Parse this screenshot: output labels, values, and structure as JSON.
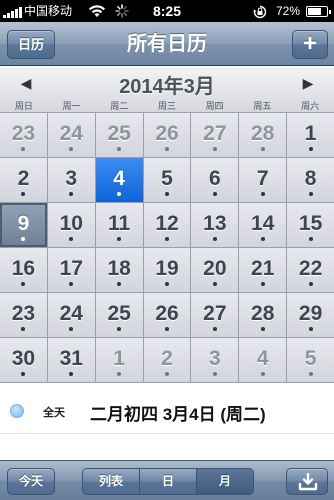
{
  "status_bar": {
    "carrier": "中国移动",
    "time": "8:25",
    "battery": "72%",
    "battery_level": 0.72,
    "icons": [
      "signal-icon",
      "wifi-icon",
      "activity-spinner-icon",
      "orientation-lock-icon",
      "battery-icon"
    ]
  },
  "nav": {
    "left_button": "日历",
    "title": "所有日历",
    "right_button": "+"
  },
  "calendar": {
    "month_title": "2014年3月",
    "prev_icon": "◀",
    "next_icon": "▶",
    "weekdays": [
      "周日",
      "周一",
      "周二",
      "周三",
      "周四",
      "周五",
      "周六"
    ],
    "weeks": [
      [
        {
          "d": "23",
          "o": true,
          "e": true
        },
        {
          "d": "24",
          "o": true,
          "e": true
        },
        {
          "d": "25",
          "o": true,
          "e": true
        },
        {
          "d": "26",
          "o": true,
          "e": true
        },
        {
          "d": "27",
          "o": true,
          "e": true
        },
        {
          "d": "28",
          "o": true,
          "e": true
        },
        {
          "d": "1",
          "o": false,
          "e": true
        }
      ],
      [
        {
          "d": "2",
          "o": false,
          "e": true
        },
        {
          "d": "3",
          "o": false,
          "e": true
        },
        {
          "d": "4",
          "o": false,
          "e": true,
          "s": true
        },
        {
          "d": "5",
          "o": false,
          "e": true
        },
        {
          "d": "6",
          "o": false,
          "e": true
        },
        {
          "d": "7",
          "o": false,
          "e": true
        },
        {
          "d": "8",
          "o": false,
          "e": true
        }
      ],
      [
        {
          "d": "9",
          "o": false,
          "e": true,
          "t": true
        },
        {
          "d": "10",
          "o": false,
          "e": true
        },
        {
          "d": "11",
          "o": false,
          "e": true
        },
        {
          "d": "12",
          "o": false,
          "e": true
        },
        {
          "d": "13",
          "o": false,
          "e": true
        },
        {
          "d": "14",
          "o": false,
          "e": true
        },
        {
          "d": "15",
          "o": false,
          "e": true
        }
      ],
      [
        {
          "d": "16",
          "o": false,
          "e": true
        },
        {
          "d": "17",
          "o": false,
          "e": true
        },
        {
          "d": "18",
          "o": false,
          "e": true
        },
        {
          "d": "19",
          "o": false,
          "e": true
        },
        {
          "d": "20",
          "o": false,
          "e": true
        },
        {
          "d": "21",
          "o": false,
          "e": true
        },
        {
          "d": "22",
          "o": false,
          "e": true
        }
      ],
      [
        {
          "d": "23",
          "o": false,
          "e": true
        },
        {
          "d": "24",
          "o": false,
          "e": true
        },
        {
          "d": "25",
          "o": false,
          "e": true
        },
        {
          "d": "26",
          "o": false,
          "e": true
        },
        {
          "d": "27",
          "o": false,
          "e": true
        },
        {
          "d": "28",
          "o": false,
          "e": true
        },
        {
          "d": "29",
          "o": false,
          "e": true
        }
      ],
      [
        {
          "d": "30",
          "o": false,
          "e": true
        },
        {
          "d": "31",
          "o": false,
          "e": true
        },
        {
          "d": "1",
          "o": true,
          "e": true
        },
        {
          "d": "2",
          "o": true,
          "e": true
        },
        {
          "d": "3",
          "o": true,
          "e": true
        },
        {
          "d": "4",
          "o": true,
          "e": true
        },
        {
          "d": "5",
          "o": true,
          "e": true
        }
      ]
    ]
  },
  "events": [
    {
      "all_day": "全天",
      "text": "二月初四 3月4日 (周二)",
      "color": "#73b3f5"
    }
  ],
  "toolbar": {
    "today": "今天",
    "segments": [
      "列表",
      "日",
      "月"
    ],
    "active_segment": 2,
    "inbox_icon": "inbox-download-icon"
  },
  "colors": {
    "selected_day": "#1a6fe0",
    "bar_blue": "#6d84a2"
  }
}
